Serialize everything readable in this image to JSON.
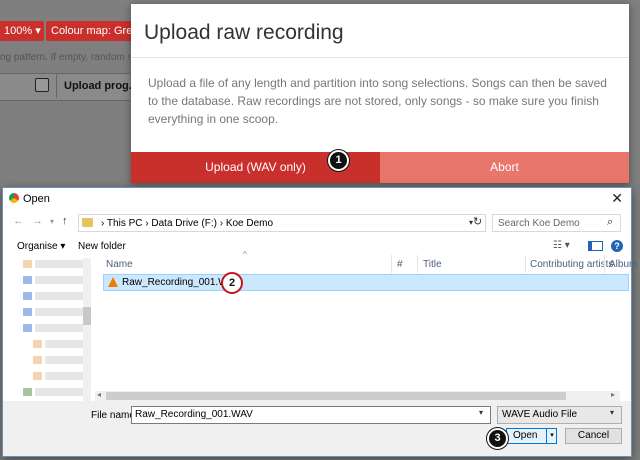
{
  "background_app": {
    "zoom_label": "100% ▾",
    "colour_map_label": "Colour map: Gree",
    "hint_text": "ng pattern. If empty, random str",
    "column_header": "Upload prog..."
  },
  "modal": {
    "title": "Upload raw recording",
    "body": "Upload a file of any length and partition into song selections. Songs can then be saved to the database. Raw recordings are not stored, only songs - so make sure you finish everything in one scoop.",
    "upload_label": "Upload (WAV only)",
    "abort_label": "Abort",
    "colors": {
      "upload": "#c9302c",
      "abort": "#e8766b"
    }
  },
  "callouts": [
    "1",
    "2",
    "3"
  ],
  "dialog": {
    "title": "Open",
    "breadcrumb": "›  This PC  ›  Data Drive (F:)  ›  Koe Demo",
    "search_placeholder": "Search Koe Demo",
    "organise_label": "Organise ▾",
    "new_folder_label": "New folder",
    "columns": [
      "Name",
      "#",
      "Title",
      "Contributing artists",
      "Album"
    ],
    "files": [
      {
        "name": "Raw_Recording_001.WAV",
        "icon": "vlc-icon",
        "selected": true
      }
    ],
    "file_name_label": "File name:",
    "file_name_value": "Raw_Recording_001.WAV",
    "file_type_value": "WAVE Audio File",
    "open_label": "Open",
    "cancel_label": "Cancel"
  }
}
